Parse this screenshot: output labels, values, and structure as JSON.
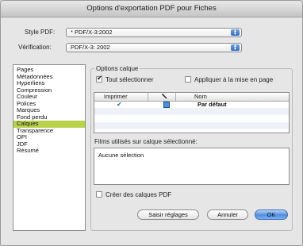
{
  "window": {
    "title": "Options d'exportation PDF pour Fiches"
  },
  "style_pdf": {
    "label": "Style PDF:",
    "value": "* PDF/X-3:2002"
  },
  "verification": {
    "label": "Vérification:",
    "value": "PDF/X-3: 2002"
  },
  "sidebar": {
    "items": [
      {
        "label": "Pages"
      },
      {
        "label": "Métadonnées"
      },
      {
        "label": "Hyperliens"
      },
      {
        "label": "Compression"
      },
      {
        "label": "Couleur"
      },
      {
        "label": "Polices"
      },
      {
        "label": "Marques"
      },
      {
        "label": "Fond perdu"
      },
      {
        "label": "Calques"
      },
      {
        "label": "Transparence"
      },
      {
        "label": "OPI"
      },
      {
        "label": "JDF"
      },
      {
        "label": "Résumé"
      }
    ],
    "selected_index": 8
  },
  "calques": {
    "group_label": "Options calque",
    "select_all": {
      "label": "Tout sélectionner",
      "checked": true
    },
    "apply_on_page": {
      "label": "Appliquer à la mise en page",
      "checked": false
    },
    "table": {
      "columns": [
        "Imprimer",
        "",
        "Nom"
      ],
      "rows": [
        {
          "print": true,
          "nom": "Par défaut"
        }
      ]
    },
    "films_label": "Films utilisés sur calque sélectionné:",
    "films_value": "Aucune sélection",
    "create_pdf_layers": {
      "label": "Créer des calques PDF",
      "checked": false
    }
  },
  "buttons": {
    "settings": "Saisir réglages",
    "cancel": "Annuler",
    "ok": "OK"
  }
}
